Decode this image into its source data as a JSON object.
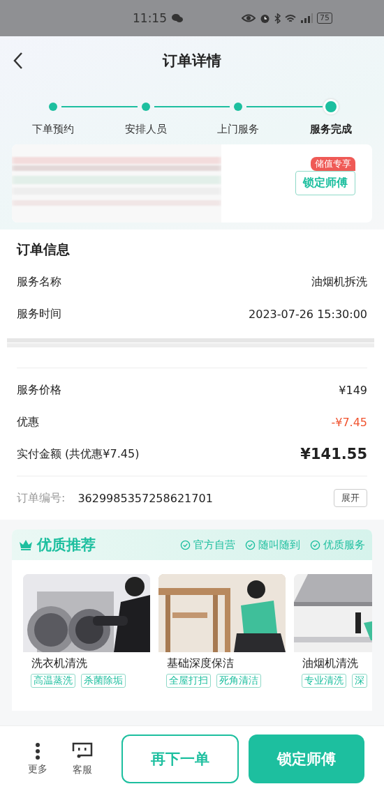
{
  "status_bar": {
    "time": "11:15",
    "battery": "75"
  },
  "header": {
    "title": "订单详情"
  },
  "steps": [
    {
      "label": "下单预约",
      "selected": false
    },
    {
      "label": "安排人员",
      "selected": false
    },
    {
      "label": "上门服务",
      "selected": false
    },
    {
      "label": "服务完成",
      "selected": true
    }
  ],
  "promo": {
    "badge": "储值专享",
    "button": "锁定师傅"
  },
  "order_info": {
    "title": "订单信息",
    "rows": [
      {
        "label": "服务名称",
        "value": "油烟机拆洗"
      },
      {
        "label": "服务时间",
        "value": "2023-07-26 15:30:00"
      }
    ]
  },
  "prices": [
    {
      "label": "服务价格",
      "value": "¥149",
      "kind": "normal"
    },
    {
      "label": "优惠",
      "value": "-¥7.45",
      "kind": "discount"
    },
    {
      "label": "实付金额 (共优惠¥7.45)",
      "value": "¥141.55",
      "kind": "total"
    }
  ],
  "order_number": {
    "label": "订单编号:",
    "value": "3629985357258621701",
    "button": "展开"
  },
  "recommend": {
    "title": "优质推荐",
    "features": [
      "官方自营",
      "随叫随到",
      "优质服务"
    ],
    "items": [
      {
        "name": "洗衣机清洗",
        "tags": [
          "高温蒸洗",
          "杀菌除垢"
        ],
        "kind": "picture"
      },
      {
        "name": "基础深度保洁",
        "tags": [
          "全屋打扫",
          "死角清洁"
        ],
        "kind": "picture"
      },
      {
        "name": "油烟机清洗",
        "tags": [
          "专业清洗",
          "深"
        ],
        "kind": "picture"
      }
    ]
  },
  "bottom_bar": {
    "actions": [
      {
        "label": "更多",
        "kind": "more"
      },
      {
        "label": "客服",
        "kind": "service"
      }
    ],
    "secondary": "再下一单",
    "primary": "锁定师傅"
  }
}
